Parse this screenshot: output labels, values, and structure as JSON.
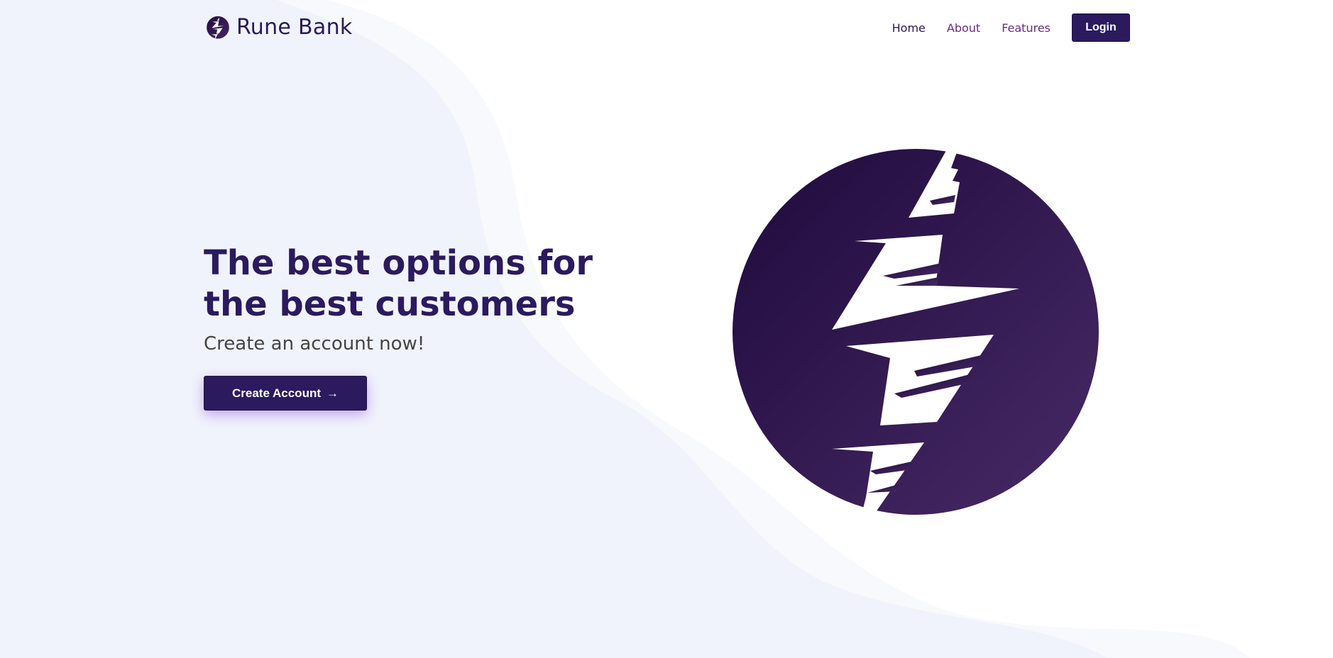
{
  "brand": {
    "name": "Rune Bank",
    "logo_icon": "lightning-bolt-circle-icon"
  },
  "nav": {
    "items": [
      {
        "label": "Home"
      },
      {
        "label": "About"
      },
      {
        "label": "Features"
      }
    ],
    "login_label": "Login"
  },
  "hero": {
    "title": "The best options for the best customers",
    "subtitle": "Create an account now!",
    "cta_label": "Create Account",
    "cta_arrow": "→",
    "illustration_icon": "lightning-bolt-circle-icon"
  },
  "colors": {
    "primary": "#2b1a5e",
    "accent_purple": "#6a2a80",
    "wave_light": "#f1f3fc"
  }
}
